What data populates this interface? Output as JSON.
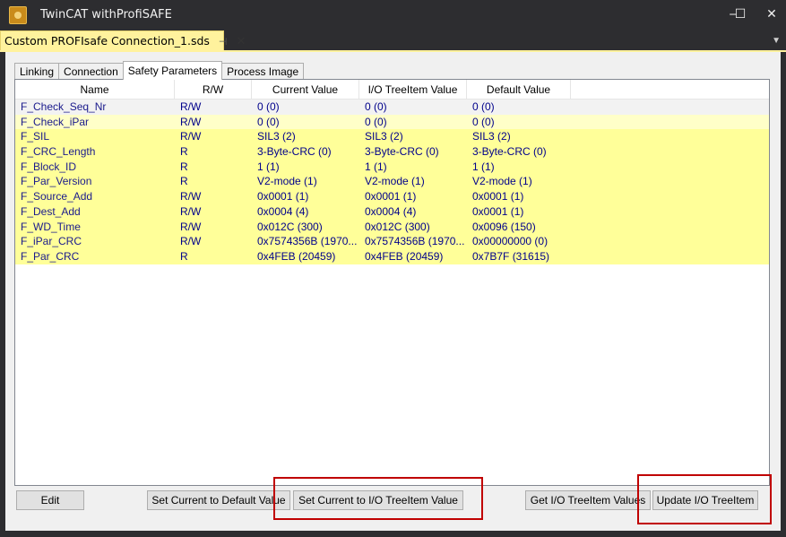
{
  "window": {
    "title": "TwinCAT withProfiSAFE",
    "minimize_glyph": "‒",
    "maximize_glyph": "☐",
    "close_glyph": "✕"
  },
  "document_tab": {
    "label": "Custom PROFIsafe Connection_1.sds",
    "pin_glyph": "⊣",
    "close_glyph": "✕"
  },
  "tabs": [
    "Linking",
    "Connection",
    "Safety Parameters",
    "Process Image"
  ],
  "active_tab": "Safety Parameters",
  "table": {
    "columns": [
      "Name",
      "R/W",
      "Current Value",
      "I/O TreeItem Value",
      "Default Value"
    ],
    "rows": [
      [
        "F_Check_Seq_Nr",
        "R/W",
        "0 (0)",
        "0 (0)",
        "0 (0)"
      ],
      [
        "F_Check_iPar",
        "R/W",
        "0 (0)",
        "0 (0)",
        "0 (0)"
      ],
      [
        "F_SIL",
        "R/W",
        "SIL3 (2)",
        "SIL3 (2)",
        "SIL3 (2)"
      ],
      [
        "F_CRC_Length",
        "R",
        "3-Byte-CRC (0)",
        "3-Byte-CRC (0)",
        "3-Byte-CRC (0)"
      ],
      [
        "F_Block_ID",
        "R",
        "1 (1)",
        "1 (1)",
        "1 (1)"
      ],
      [
        "F_Par_Version",
        "R",
        "V2-mode (1)",
        "V2-mode (1)",
        "V2-mode (1)"
      ],
      [
        "F_Source_Add",
        "R/W",
        "0x0001 (1)",
        "0x0001 (1)",
        "0x0001 (1)"
      ],
      [
        "F_Dest_Add",
        "R/W",
        "0x0004 (4)",
        "0x0004 (4)",
        "0x0001 (1)"
      ],
      [
        "F_WD_Time",
        "R/W",
        "0x012C (300)",
        "0x012C (300)",
        "0x0096 (150)"
      ],
      [
        "F_iPar_CRC",
        "R/W",
        "0x7574356B (1970...",
        "0x7574356B (1970...",
        "0x00000000 (0)"
      ],
      [
        "F_Par_CRC",
        "R",
        "0x4FEB (20459)",
        "0x4FEB (20459)",
        "0x7B7F (31615)"
      ]
    ]
  },
  "buttons": {
    "edit": "Edit",
    "set_default": "Set Current to Default Value",
    "set_io": "Set Current to I/O TreeItem Value",
    "get_io": "Get I/O TreeItem Values",
    "update_io": "Update I/O TreeItem"
  },
  "colors": {
    "row_highlight": "#ffff99",
    "annotation_box": "#c00000"
  }
}
